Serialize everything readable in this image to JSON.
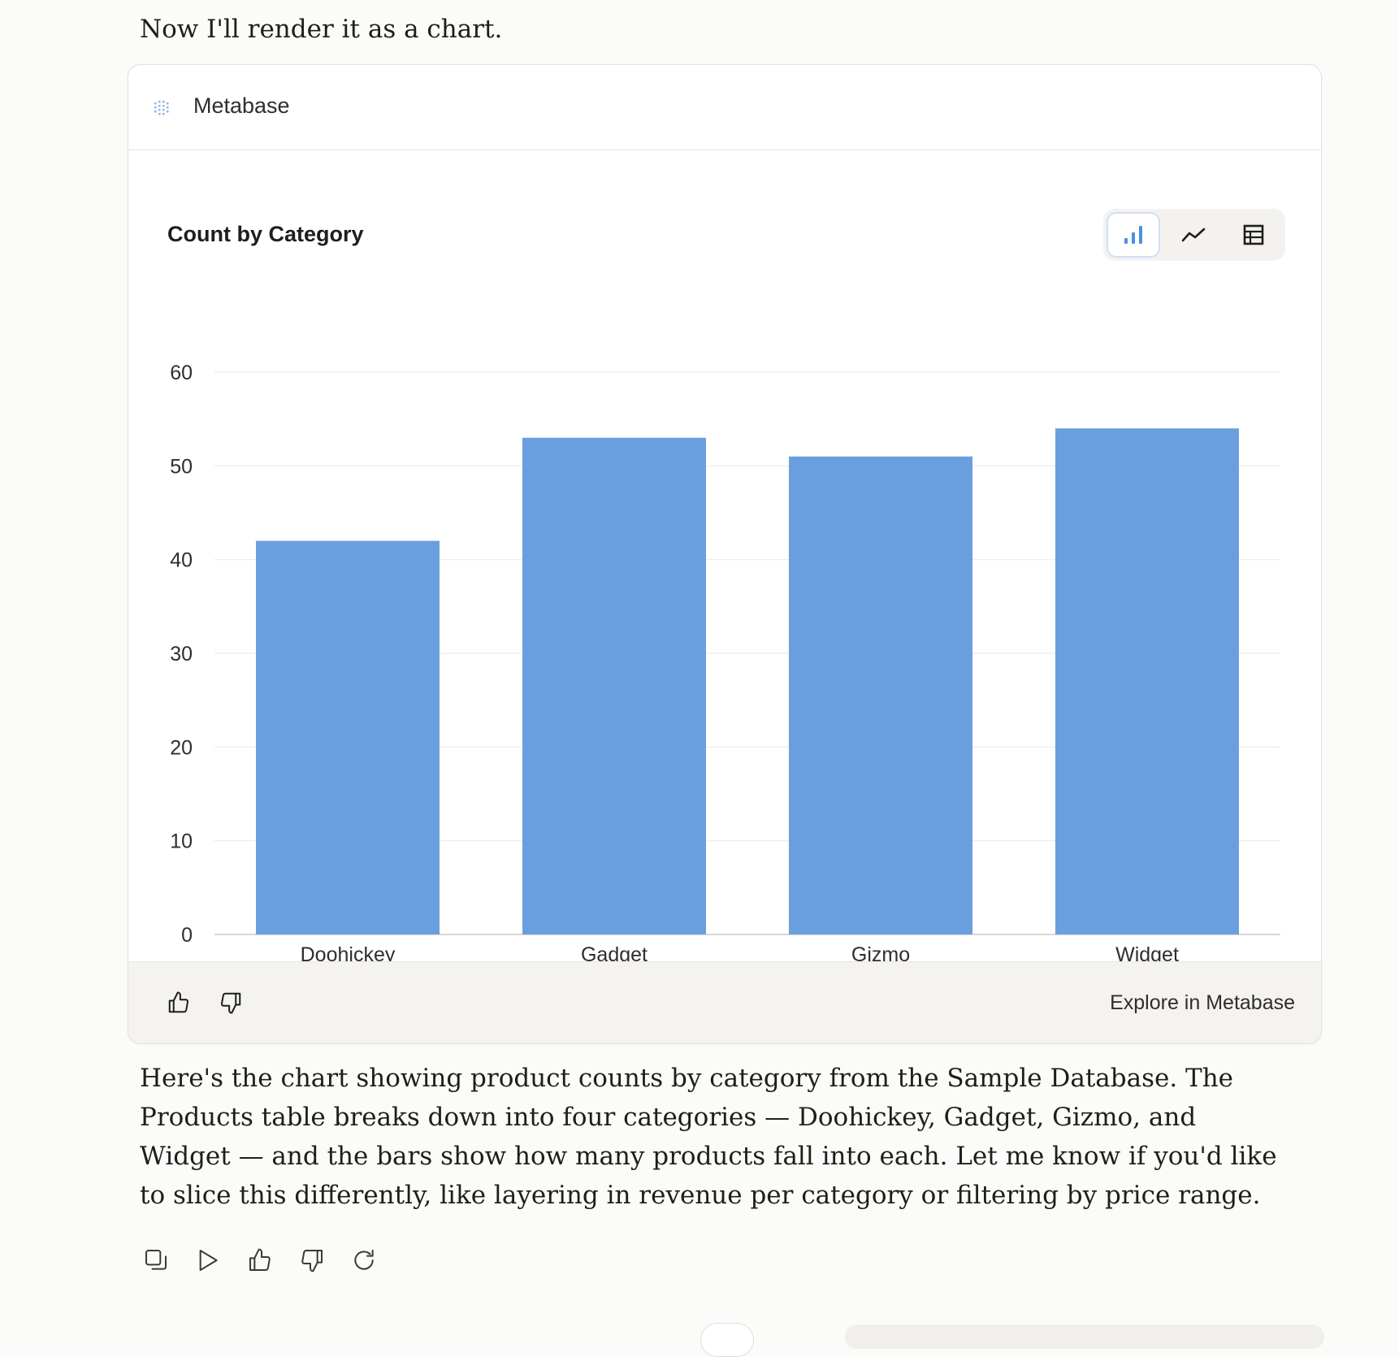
{
  "intro_text": "Now I'll render it as a chart.",
  "card": {
    "app_name": "Metabase",
    "chart_title": "Count by Category",
    "viz_toggle": {
      "active": "bar",
      "options": [
        {
          "name": "bar",
          "icon": "bar-chart-icon"
        },
        {
          "name": "line",
          "icon": "line-chart-icon"
        },
        {
          "name": "table",
          "icon": "table-icon"
        }
      ]
    },
    "footer": {
      "explore_label": "Explore in Metabase"
    }
  },
  "chart_data": {
    "type": "bar",
    "categories": [
      "Doohickey",
      "Gadget",
      "Gizmo",
      "Widget"
    ],
    "values": [
      42,
      53,
      51,
      54
    ],
    "title": "Count by Category",
    "xlabel": "",
    "ylabel": "",
    "ylim": [
      0,
      60
    ],
    "yticks": [
      0,
      10,
      20,
      30,
      40,
      50,
      60
    ],
    "grid": true,
    "bar_color": "#6a9fdf"
  },
  "response_text": "Here's the chart showing product counts by category from the Sample Database. The Products table breaks down into four categories — Doohickey, Gadget, Gizmo, and Widget — and the bars show how many products fall into each. Let me know if you'd like to slice this differently, like layering in revenue per category or filtering by price range.",
  "colors": {
    "accent": "#6a9fdf",
    "page_bg": "#fbfbfa",
    "footer_bg": "#f4f3ef"
  }
}
